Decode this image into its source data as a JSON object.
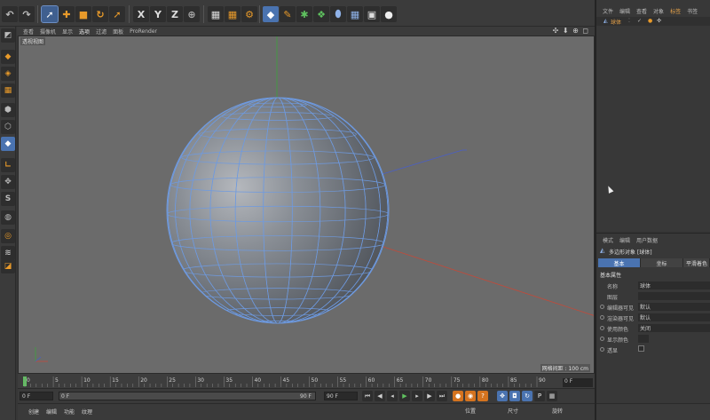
{
  "viewport": {
    "menu": [
      "查看",
      "摄像机",
      "显示",
      "选项",
      "过滤",
      "面板",
      "ProRender"
    ],
    "active_menu": "选项",
    "camera_label": "透视视图",
    "grid_label": "网格间距 : 100 cm",
    "nav_icons": "✣ ⬇ ⊕ ◻"
  },
  "toolbar": {
    "axis_x": "X",
    "axis_y": "Y",
    "axis_z": "Z"
  },
  "timeline": {
    "ticks": [
      "0",
      "5",
      "10",
      "15",
      "20",
      "25",
      "30",
      "35",
      "40",
      "45",
      "50",
      "55",
      "60",
      "65",
      "70",
      "75",
      "80",
      "85",
      "90"
    ],
    "current_frame": "0 F",
    "start_frame": "0 F",
    "range_start": "0 F",
    "range_end": "90 F",
    "end_frame": "90 F"
  },
  "bottom": {
    "tabs": [
      "创建",
      "编辑",
      "功能",
      "纹理"
    ],
    "coords": [
      "位置",
      "尺寸",
      "旋转"
    ]
  },
  "object_manager": {
    "menu": [
      "文件",
      "编辑",
      "查看",
      "对象",
      "标签",
      "书签"
    ],
    "object_name": "球体"
  },
  "attributes": {
    "menu": [
      "模式",
      "编辑",
      "用户数据"
    ],
    "title": "多边形对象 [球体]",
    "tabs": [
      "基本",
      "坐标",
      "平滑着色"
    ],
    "section": "基本属性",
    "rows": [
      {
        "label": "名称",
        "value": "球体"
      },
      {
        "label": "图层",
        "value": ""
      },
      {
        "label": "编辑器可见",
        "value": "默认"
      },
      {
        "label": "渲染器可见",
        "value": "默认"
      },
      {
        "label": "使用颜色",
        "value": "关闭"
      },
      {
        "label": "显示颜色",
        "value": ""
      },
      {
        "label": "透显",
        "value": ""
      }
    ]
  },
  "colors": {
    "accent": "#4a73b0",
    "sphere_wire": "#6e9ae0",
    "viewport_bg": "#6b6b6b",
    "axis_x": "#c24a3a",
    "axis_y": "#3da33d",
    "axis_z": "#4a5fc4"
  }
}
